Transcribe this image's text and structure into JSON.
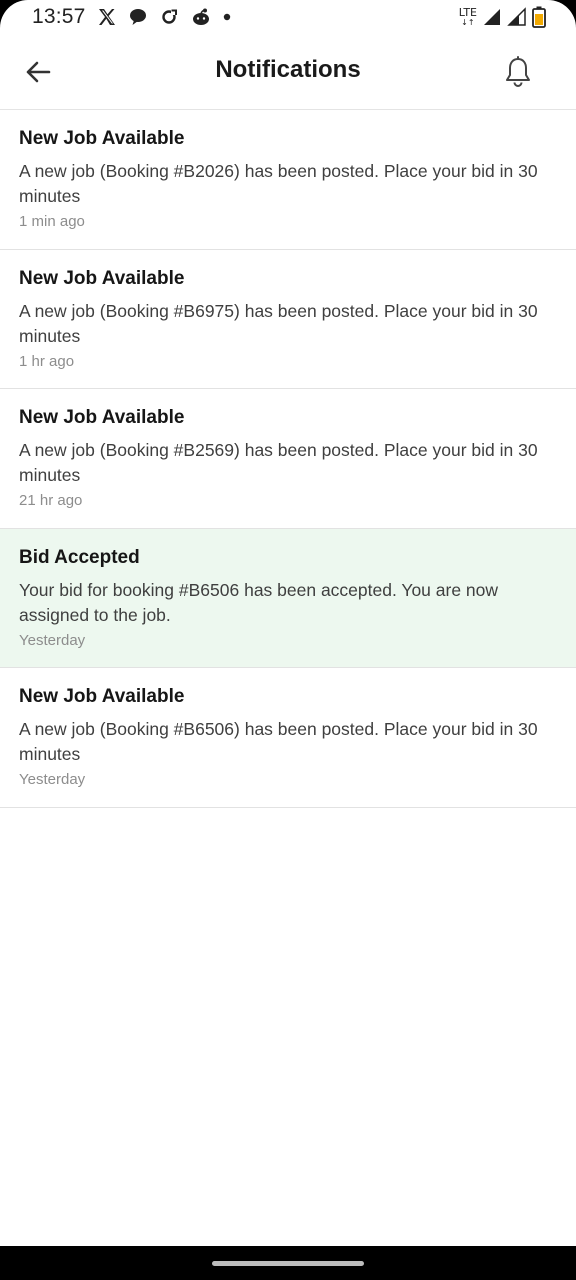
{
  "status_bar": {
    "time": "13:57",
    "network_label": "LTE",
    "icons": [
      "x-icon",
      "chat-bubble-icon",
      "sync-icon",
      "reddit-icon",
      "dot-icon",
      "signal-icon",
      "signal-partial-icon",
      "battery-icon"
    ]
  },
  "header": {
    "title": "Notifications",
    "back_icon": "arrow-left-icon",
    "bell_icon": "bell-icon"
  },
  "notifications": [
    {
      "title": "New Job Available",
      "body": "A new job (Booking #B2026) has been posted. Place your bid in 30 minutes",
      "time": "1 min ago",
      "highlighted": false
    },
    {
      "title": "New Job Available",
      "body": "A new job (Booking #B6975) has been posted. Place your bid in 30 minutes",
      "time": "1 hr ago",
      "highlighted": false
    },
    {
      "title": "New Job Available",
      "body": "A new job (Booking #B2569) has been posted. Place your bid in 30 minutes",
      "time": "21 hr ago",
      "highlighted": false
    },
    {
      "title": "Bid Accepted",
      "body": "Your bid for booking #B6506 has been accepted. You are now assigned to the job.",
      "time": "Yesterday",
      "highlighted": true
    },
    {
      "title": "New Job Available",
      "body": "A new job (Booking #B6506) has been posted. Place your bid in 30 minutes",
      "time": "Yesterday",
      "highlighted": false
    }
  ],
  "colors": {
    "highlight_background": "#edf8ef",
    "battery_fill": "#f2a900"
  }
}
